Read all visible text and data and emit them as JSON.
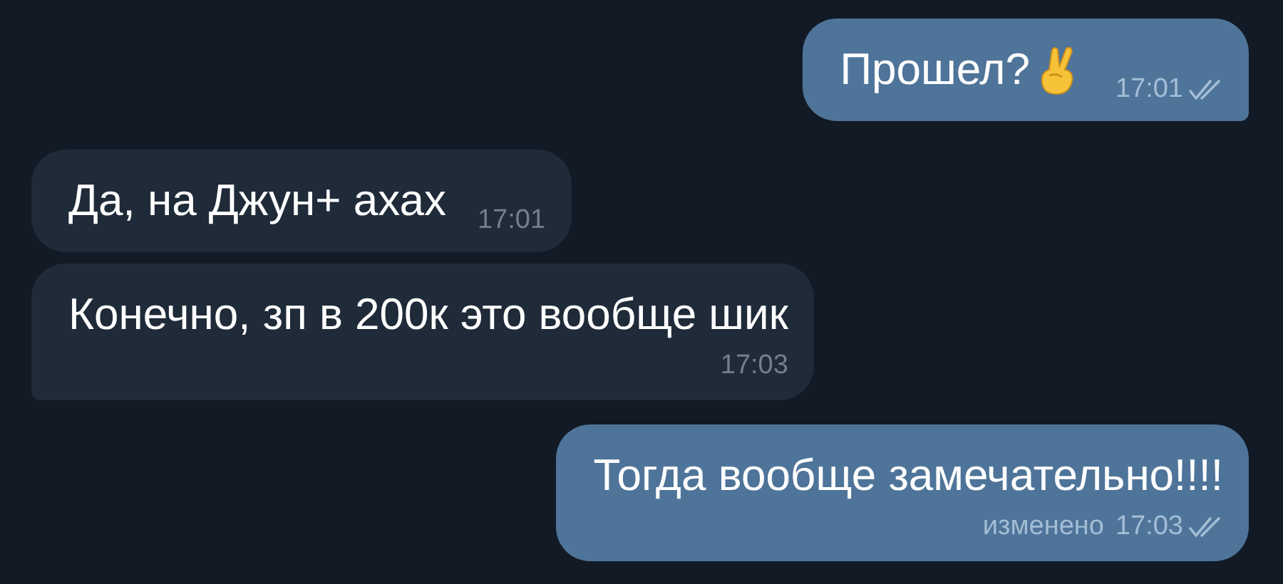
{
  "messages": [
    {
      "kind": "outgoing",
      "text": "Прошел?",
      "emoji": true,
      "time": "17:01",
      "read": true,
      "tail": true,
      "time_below": false
    },
    {
      "kind": "incoming",
      "text": "Да, на Джун+ ахах",
      "emoji": false,
      "time": "17:01",
      "read": false,
      "tail": false,
      "time_below": false
    },
    {
      "kind": "incoming",
      "text": "Конечно, зп в 200к это вообще шик",
      "emoji": false,
      "time": "17:03",
      "read": false,
      "tail": true,
      "time_below": true
    },
    {
      "kind": "outgoing",
      "text": "Тогда вообще замечательно!!!!",
      "emoji": false,
      "edited": "изменено",
      "time": "17:03",
      "read": true,
      "tail": false,
      "time_below": true
    }
  ]
}
